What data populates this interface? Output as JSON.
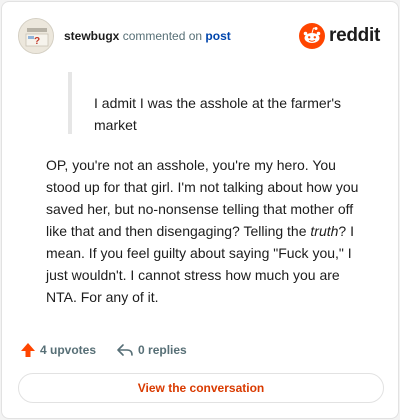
{
  "author": {
    "username": "stewbugx",
    "action_text": "commented on",
    "target_link": "post"
  },
  "brand": {
    "name": "reddit",
    "icon": "reddit-alien-icon",
    "color": "#ff4500"
  },
  "quoted": {
    "text": "I admit I was the asshole at the farmer's market"
  },
  "comment": {
    "before_italic": "OP, you're not an asshole, you're my hero. You stood up for that girl. I'm not talking about how you saved her, but no-nonsense telling that mother off like that and then disengaging? Telling the ",
    "italic": "truth",
    "after_italic": "? I mean. If you feel guilty about saying \"Fuck you,\" I just wouldn't. I cannot stress how much you are NTA. For any of it."
  },
  "stats": {
    "upvotes": "4 upvotes",
    "replies": "0 replies",
    "upvote_icon": "upvote-arrow-icon",
    "reply_icon": "reply-arrow-icon"
  },
  "cta": {
    "label": "View the conversation"
  },
  "colors": {
    "accent": "#d93a00",
    "upvote": "#ff4500",
    "link": "#0045ac"
  }
}
